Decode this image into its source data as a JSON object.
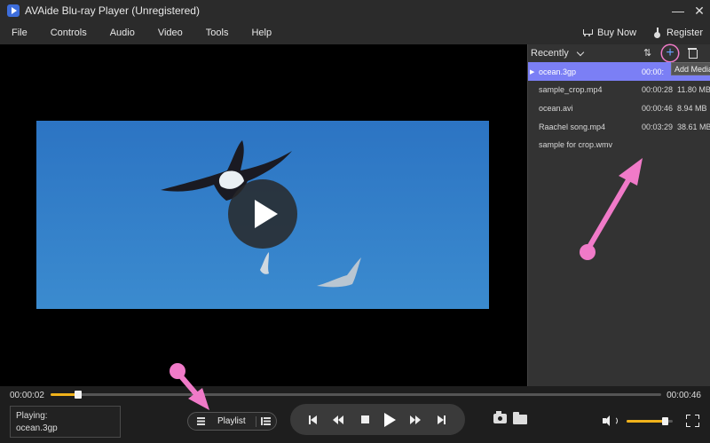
{
  "window": {
    "title": "AVAide Blu-ray Player (Unregistered)",
    "minimize_glyph": "—",
    "close_glyph": "✕"
  },
  "menu": {
    "items": [
      "File",
      "Controls",
      "Audio",
      "Video",
      "Tools",
      "Help"
    ],
    "buy_now": "Buy Now",
    "register": "Register"
  },
  "playlist": {
    "sort_label": "Recently",
    "sort_glyph": "⇅",
    "add_glyph": "+",
    "add_tooltip": "Add Media",
    "items": [
      {
        "name": "ocean.3gp",
        "duration": "00:00:",
        "size": "",
        "active": true,
        "marker": "▶"
      },
      {
        "name": "sample_crop.mp4",
        "duration": "00:00:28",
        "size": "11.80 MB",
        "active": false
      },
      {
        "name": "ocean.avi",
        "duration": "00:00:46",
        "size": "8.94 MB",
        "active": false
      },
      {
        "name": "Raachel song.mp4",
        "duration": "00:03:29",
        "size": "38.61 MB",
        "active": false
      },
      {
        "name": "sample for crop.wmv",
        "duration": "",
        "size": "",
        "active": false
      }
    ]
  },
  "playback": {
    "current_time": "00:00:02",
    "total_time": "00:00:46",
    "progress_fraction": 0.045,
    "volume_fraction": 0.82
  },
  "now_playing": {
    "label": "Playing:",
    "file": "ocean.3gp"
  },
  "playlist_toggle": {
    "label": "Playlist"
  },
  "colors": {
    "accent_progress": "#f0b21b",
    "active_row": "#7b7ff5",
    "annotation_pink": "#f07ac8"
  }
}
